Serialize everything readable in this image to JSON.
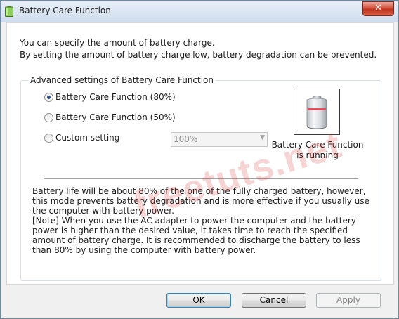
{
  "window": {
    "title": "Battery Care Function",
    "close_glyph": "✕"
  },
  "intro": {
    "line1": "You can specify the amount of battery charge.",
    "line2": "By setting the amount of battery charge low, battery degradation can be prevented."
  },
  "group": {
    "label": "Advanced settings of Battery Care Function",
    "options": [
      {
        "label": "Battery Care Function (80%)",
        "checked": true
      },
      {
        "label": "Battery Care Function (50%)",
        "checked": false
      },
      {
        "label": "Custom setting",
        "checked": false
      }
    ],
    "custom_select": {
      "value": "100%",
      "enabled": false
    },
    "status": {
      "line1": "Battery Care Function",
      "line2": "is running",
      "icon": "battery-icon"
    },
    "description": {
      "para1": "Battery life will be about 80% of the one of the fully charged battery, however, this mode prevents battery degradation and is more effective if you usually use the computer with battery power.",
      "para2": "[Note] When you use the AC adapter to power the computer and the battery power is higher than the desired value, it takes time to reach the specified amount of battery charge. It is recommended to discharge the battery to less than 80% by using the computer with battery power."
    }
  },
  "buttons": {
    "ok": "OK",
    "cancel": "Cancel",
    "apply": "Apply"
  },
  "watermark": "freetuts.net",
  "colors": {
    "accent": "#2b4c82",
    "battery_charge_line": "#e84c5a",
    "close_button": "#c0321c"
  }
}
